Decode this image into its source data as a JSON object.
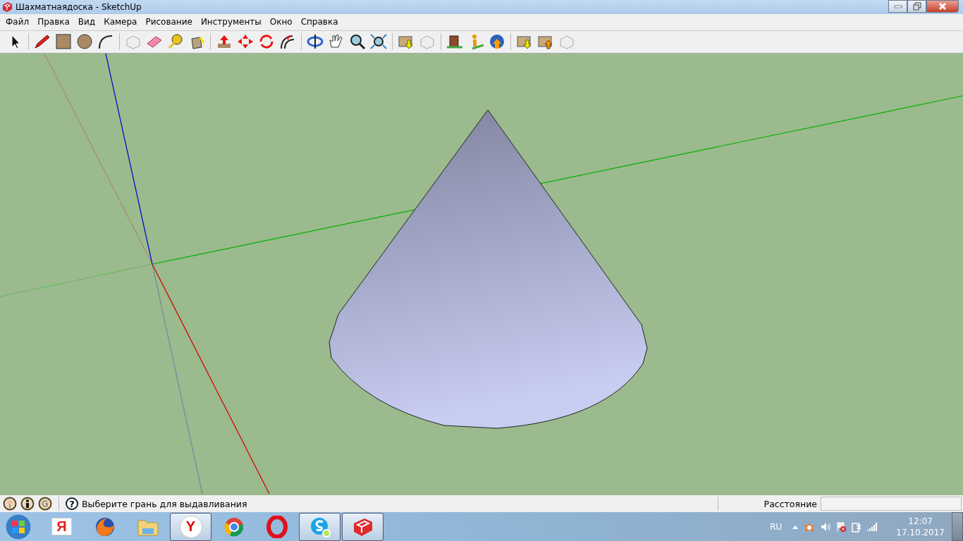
{
  "window": {
    "title": "Шахматнаядоска - SketchUp"
  },
  "menu": [
    {
      "label": "Файл"
    },
    {
      "label": "Правка"
    },
    {
      "label": "Вид"
    },
    {
      "label": "Камера"
    },
    {
      "label": "Рисование"
    },
    {
      "label": "Инструменты"
    },
    {
      "label": "Окно"
    },
    {
      "label": "Справка"
    }
  ],
  "status_bar": {
    "help_glyph": "?",
    "message": "Выберите грань для выдавливания",
    "measurement_label": "Расстояние"
  },
  "taskbar": {
    "apps": [
      {
        "kind": "letter-tile",
        "glyph": "Я",
        "open": false
      },
      {
        "kind": "fox",
        "open": false
      },
      {
        "kind": "folder",
        "open": false
      },
      {
        "kind": "letter-round",
        "glyph": "Y",
        "open": true
      },
      {
        "kind": "ring",
        "open": false
      },
      {
        "kind": "o-ring",
        "open": false
      },
      {
        "kind": "chat",
        "open": true
      },
      {
        "kind": "cube",
        "open": true
      }
    ],
    "language": "RU",
    "time": "12:07",
    "date": "17.10.2017"
  }
}
